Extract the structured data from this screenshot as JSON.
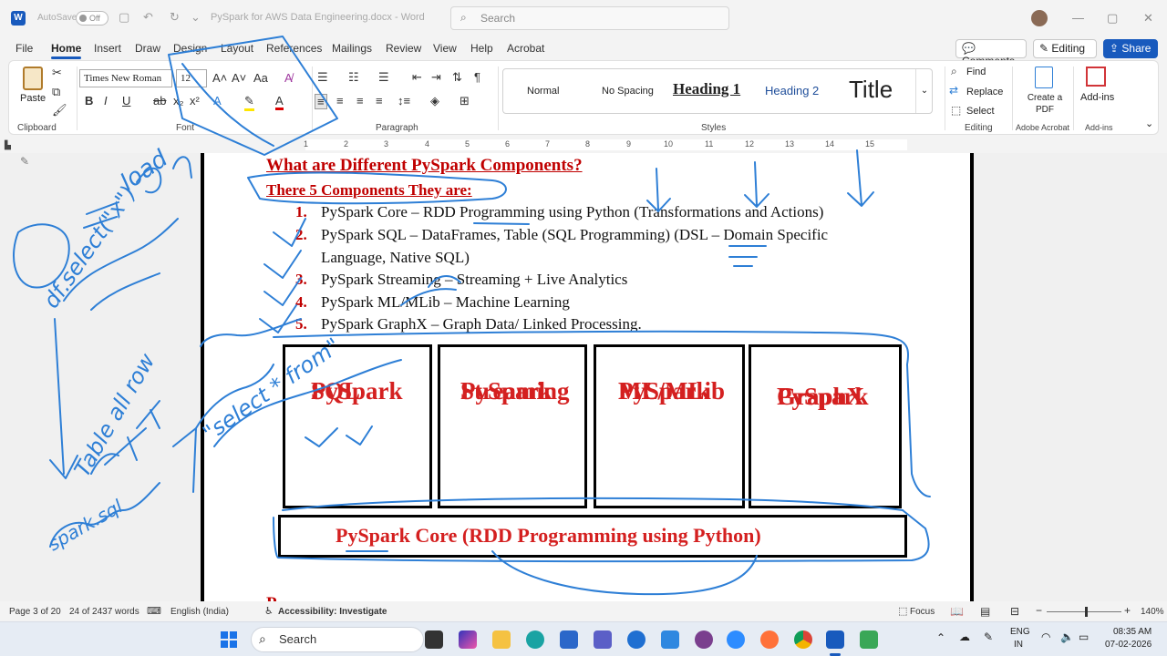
{
  "titlebar": {
    "autosave_label": "AutoSave",
    "autosave_state": "Off",
    "title": "PySpark for AWS Data Engineering.docx  -  Word",
    "search_placeholder": "Search"
  },
  "tabs": [
    "File",
    "Home",
    "Insert",
    "Draw",
    "Design",
    "Layout",
    "References",
    "Mailings",
    "Review",
    "View",
    "Help",
    "Acrobat"
  ],
  "active_tab": "Home",
  "ribbon_buttons": {
    "comments": "Comments",
    "editing": "Editing",
    "share": "Share"
  },
  "ribbon": {
    "clipboard": {
      "paste": "Paste",
      "label": "Clipboard"
    },
    "font": {
      "name": "Times New Roman",
      "size": "12",
      "label": "Font"
    },
    "paragraph": {
      "label": "Paragraph"
    },
    "styles": {
      "items": [
        "Normal",
        "No Spacing",
        "Heading 1",
        "Heading 2",
        "Title"
      ],
      "label": "Styles"
    },
    "editing": {
      "find": "Find",
      "replace": "Replace",
      "select": "Select",
      "label": "Editing"
    },
    "acrobat": {
      "create_pdf": "Create a PDF",
      "label": "Adobe Acrobat"
    },
    "addins": {
      "button": "Add-ins",
      "label": "Add-ins"
    }
  },
  "ruler": [
    "1",
    "2",
    "3",
    "4",
    "5",
    "6",
    "7",
    "8",
    "9",
    "10",
    "11",
    "12",
    "13",
    "14",
    "15"
  ],
  "document": {
    "heading": "What are Different PySpark Components?",
    "subheading": "There 5 Components They are:",
    "items": [
      {
        "num": "1.",
        "text": "PySpark Core – RDD Programming using Python (Transformations and Actions)"
      },
      {
        "num": "2.",
        "text": "PySpark SQL – DataFrames, Table (SQL Programming) (DSL – Domain Specific",
        "cont": "Language, Native SQL)"
      },
      {
        "num": "3.",
        "text": "PySpark Streaming – Streaming + Live Analytics"
      },
      {
        "num": "4.",
        "text": "PySpark ML/MLib – Machine Learning"
      },
      {
        "num": "5.",
        "text": "PySpark GraphX – Graph Data/ Linked Processing."
      }
    ],
    "diagram": {
      "boxes": [
        {
          "line1": "PySpark",
          "line2": "SQL"
        },
        {
          "line1": "PySpark",
          "line2": "Streaming"
        },
        {
          "line1": "PySpark",
          "line2": "ML/MLib"
        },
        {
          "line1": "PySpark",
          "line2": "GraphX"
        }
      ],
      "core": "PySpark Core (RDD Programming using Python)"
    },
    "next_fragment": "P"
  },
  "statusbar": {
    "page": "Page 3 of 20",
    "words": "24 of 2437 words",
    "language": "English (India)",
    "accessibility": "Accessibility: Investigate",
    "focus": "Focus",
    "zoom": "140%"
  },
  "taskbar": {
    "search": "Search",
    "lang_line1": "ENG",
    "lang_line2": "IN",
    "time": "08:35 AM",
    "date": "07-02-2026"
  },
  "colors": {
    "accent": "#185abd",
    "doc_red": "#c00000",
    "ink_blue": "#2e7fd6"
  }
}
